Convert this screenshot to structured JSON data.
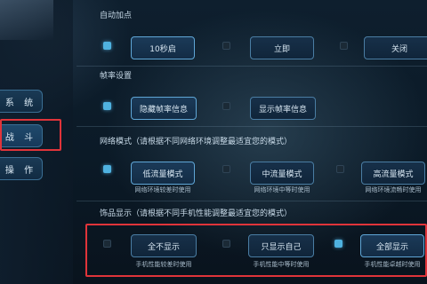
{
  "sidebar": {
    "items": [
      {
        "label": "系 统"
      },
      {
        "label": "战 斗"
      },
      {
        "label": "操 作"
      }
    ]
  },
  "auto_attack": {
    "title": "自动加点",
    "options": [
      {
        "label": "10秒启",
        "checked": true
      },
      {
        "label": "立即",
        "checked": false
      },
      {
        "label": "关闭",
        "checked": false
      }
    ]
  },
  "frame_rate": {
    "title": "帧率设置",
    "options": [
      {
        "label": "隐藏帧率信息",
        "checked": true
      },
      {
        "label": "显示帧率信息",
        "checked": false
      }
    ]
  },
  "network_mode": {
    "title": "网络模式（请根据不同网络环境调整最适宜您的模式）",
    "options": [
      {
        "label": "低流量模式",
        "sub": "网络环境较差时使用",
        "checked": true
      },
      {
        "label": "中流量模式",
        "sub": "网络环境中等时使用",
        "checked": false
      },
      {
        "label": "高流量模式",
        "sub": "网络环境流畅时使用",
        "checked": false
      }
    ]
  },
  "accessory_display": {
    "title": "饰品显示（请根据不同手机性能调整最适宜您的模式）",
    "options": [
      {
        "label": "全不显示",
        "sub": "手机性能较差时使用",
        "checked": false
      },
      {
        "label": "只显示自己",
        "sub": "手机性能中等时使用",
        "checked": false
      },
      {
        "label": "全部显示",
        "sub": "手机性能卓越时使用",
        "checked": true
      }
    ]
  },
  "colors": {
    "accent": "#4fb2e0",
    "highlight": "#e0343a",
    "button_border": "#4a7da3"
  }
}
